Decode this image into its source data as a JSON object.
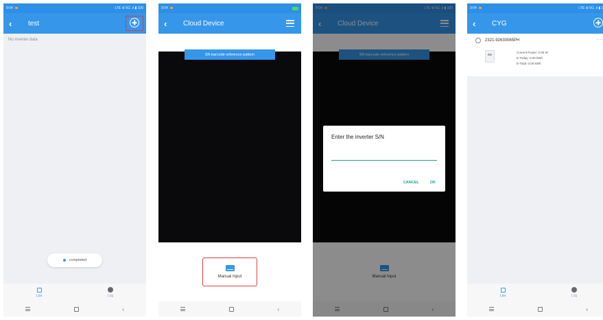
{
  "status_time": "9:04",
  "status_icons": "LTE ⊕ 5G .ıl ▮ 100",
  "screen1": {
    "title": "test",
    "empty_text": "No inverter data",
    "toast": "completed"
  },
  "screen2": {
    "title": "Cloud Device",
    "banner": "SN barcode reference pattern",
    "manual_label": "Manual Input"
  },
  "screen3": {
    "title": "Cloud Device",
    "banner": "SN barcode reference pattern",
    "dialog_title": "Enter the inverter S/N",
    "input_value": "",
    "cancel": "CANCEL",
    "ok": "OK",
    "manual_label": "Manual Input"
  },
  "screen4": {
    "title": "CYG",
    "serial": "2321-92630065PH",
    "current_power": "Current Power: 0.00 W",
    "e_today": "E-Today: 0.00 kWh",
    "e_total": "E-Total: 0.00 kWh",
    "more": "···"
  },
  "tabs": {
    "list": "List",
    "log": "Log"
  },
  "nav": {
    "back_glyph": "‹"
  }
}
